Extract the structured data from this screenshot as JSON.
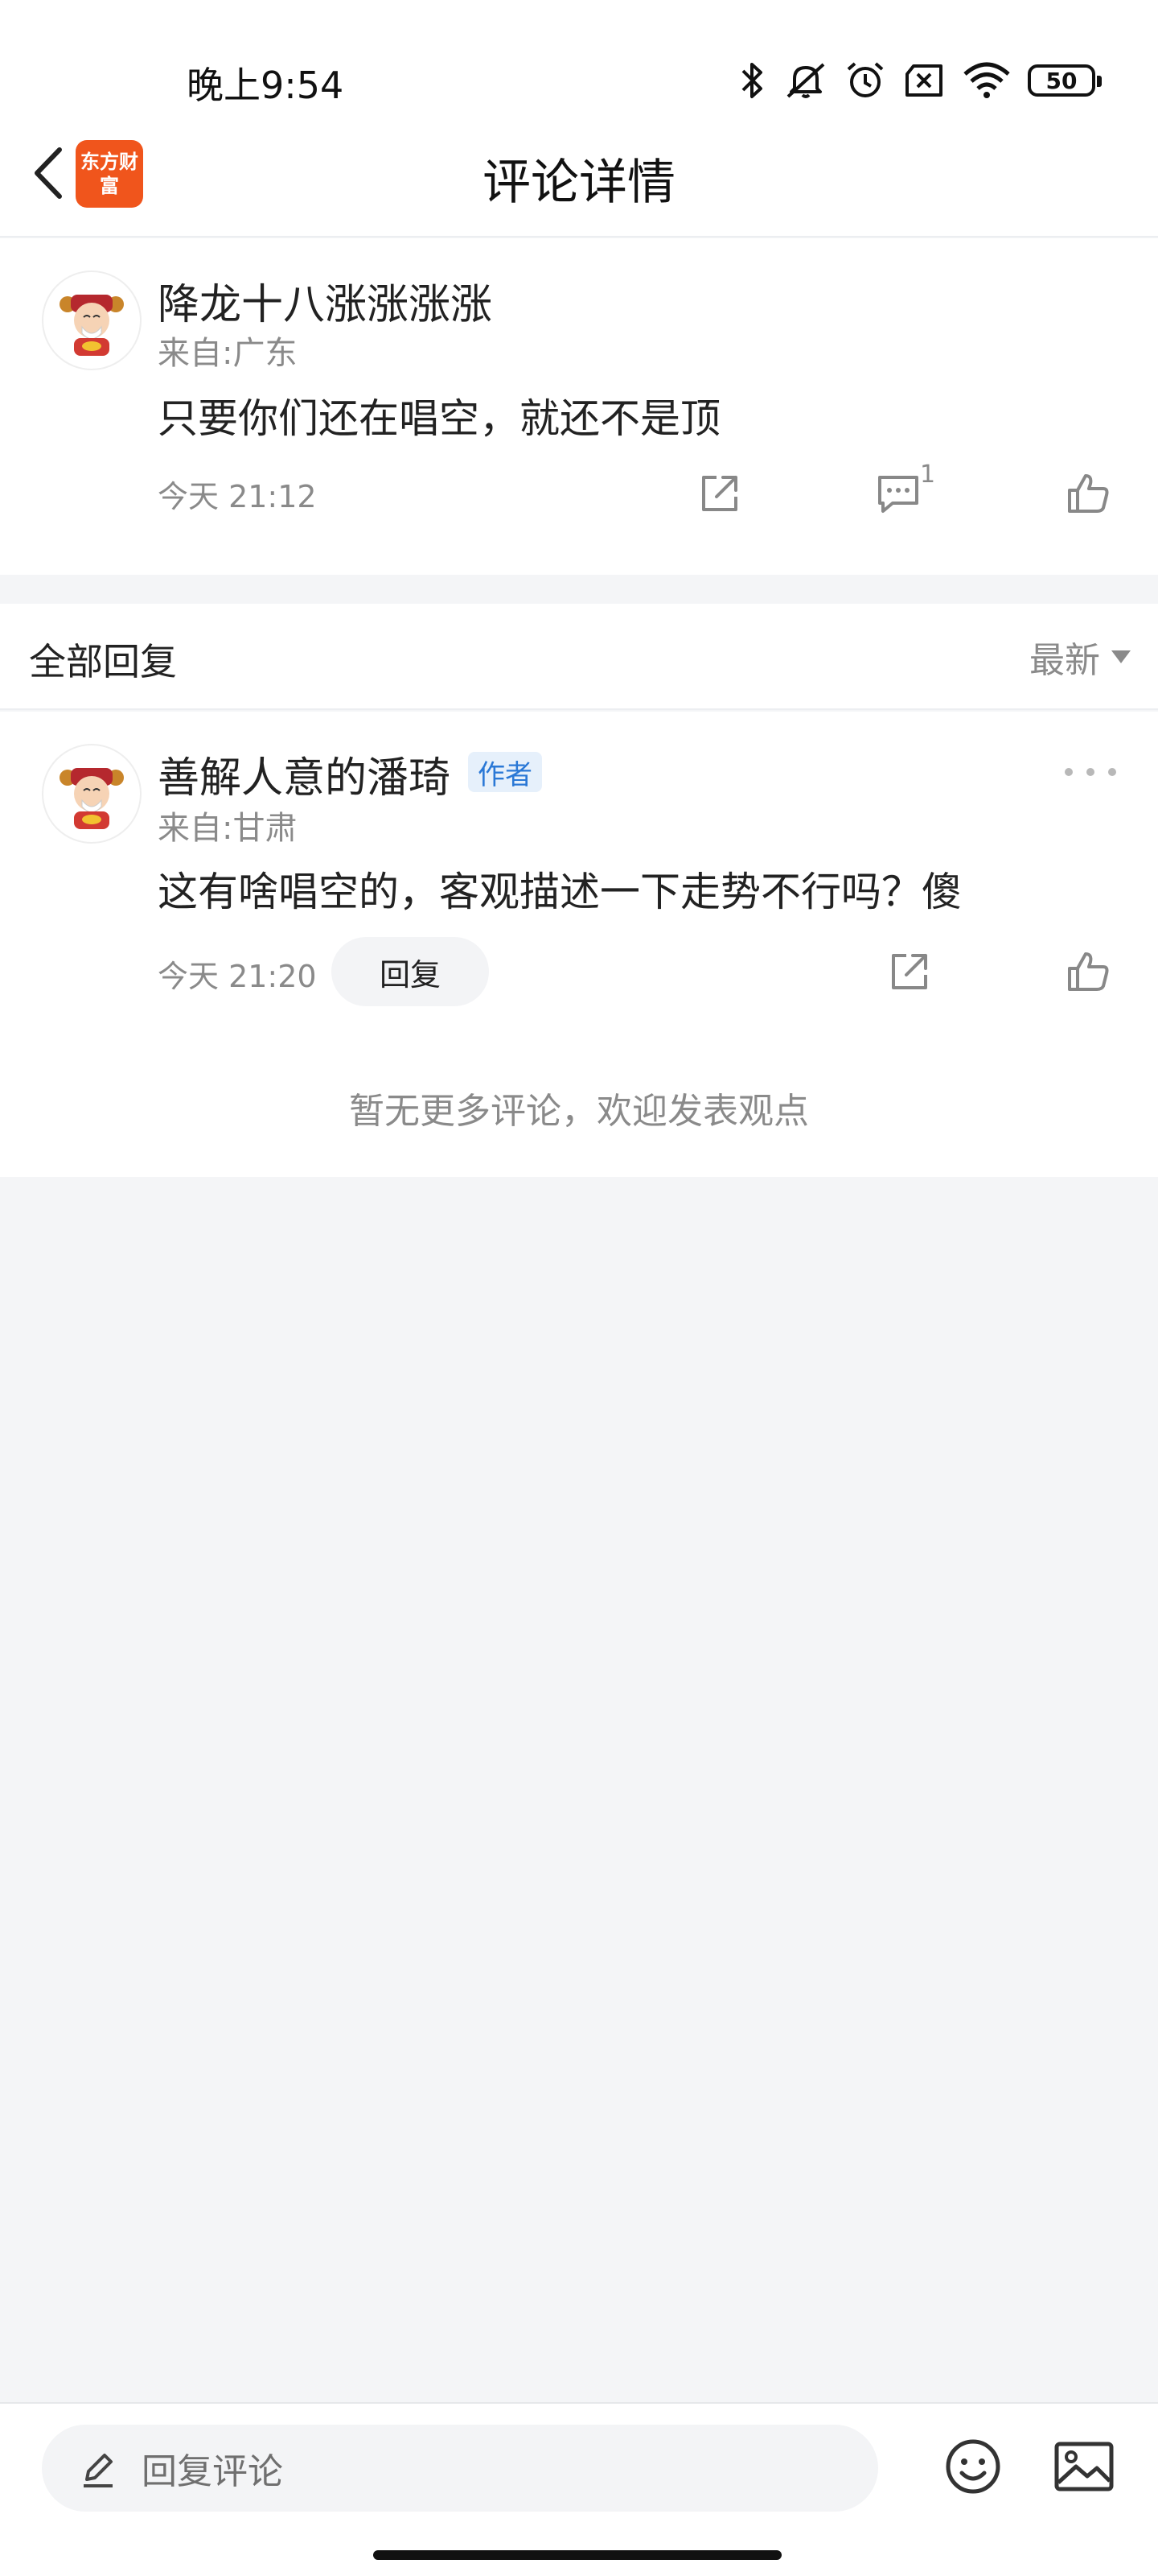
{
  "status_bar": {
    "time": "晚上9:54",
    "battery": "50",
    "icons": [
      "bluetooth-icon",
      "mute-icon",
      "alarm-icon",
      "no-sim-icon",
      "wifi-icon",
      "battery-icon"
    ]
  },
  "nav": {
    "title": "评论详情",
    "logo_text": "东方财富"
  },
  "main_comment": {
    "username": "降龙十八涨涨涨涨",
    "location": "来自:广东",
    "text": "只要你们还在唱空，就还不是顶",
    "time": "今天 21:12",
    "reply_count": "1"
  },
  "replies": {
    "title": "全部回复",
    "sort": "最新",
    "items": [
      {
        "username": "善解人意的潘琦",
        "badge": "作者",
        "location": "来自:甘肃",
        "text": "这有啥唱空的，客观描述一下走势不行吗？傻",
        "time": "今天 21:20",
        "reply_label": "回复"
      }
    ],
    "no_more": "暂无更多评论，欢迎发表观点"
  },
  "bottom_bar": {
    "placeholder": "回复评论"
  },
  "colors": {
    "brand": "#f0551c",
    "badge_blue": "#2a78d6",
    "page_bg": "#f4f5f7"
  }
}
